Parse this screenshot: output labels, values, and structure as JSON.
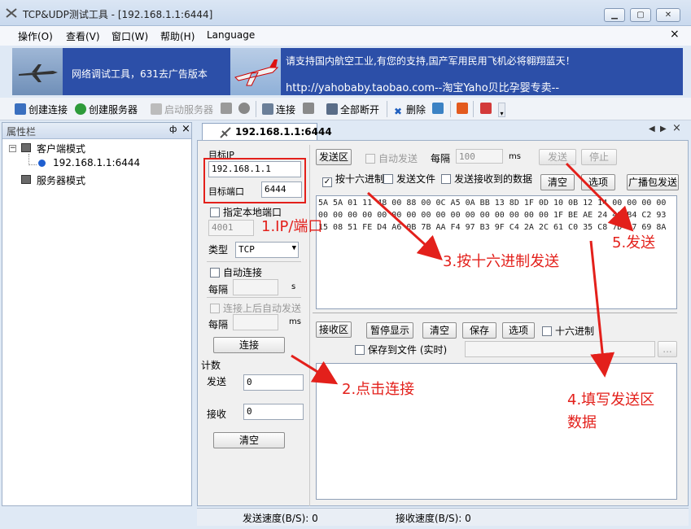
{
  "window": {
    "title": "TCP&UDP测试工具 - [192.168.1.1:6444]"
  },
  "menu": {
    "items": [
      "操作(O)",
      "查看(V)",
      "窗口(W)",
      "帮助(H)",
      "Language"
    ],
    "close": "×"
  },
  "banner": {
    "left_text": "网络调试工具，631去广告版本",
    "right_line1": "请支持国内航空工业,有您的支持,国产军用民用飞机必将翱翔蓝天！",
    "right_line2": "http://yahobaby.taobao.com--淘宝Yaho贝比孕婴专卖--"
  },
  "toolbar": {
    "create_connection": "创建连接",
    "create_server": "创建服务器",
    "start_server": "启动服务器",
    "connect": "连接",
    "disconnect_all": "全部断开",
    "delete": "删除"
  },
  "left_panel": {
    "title": "属性栏",
    "pin": "ф",
    "close": "×",
    "tree": {
      "client_mode": "客户端模式",
      "connection": "192.168.1.1:6444",
      "server_mode": "服务器模式"
    }
  },
  "tab": {
    "label": "192.168.1.1:6444"
  },
  "config": {
    "target_ip_label": "目标IP",
    "target_ip_value": "192.168.1.1",
    "target_port_label": "目标端口",
    "target_port_value": "6444",
    "local_port_label": "指定本地端口",
    "local_port_value": "4001",
    "type_label": "类型",
    "type_value": "TCP",
    "auto_connect_label": "自动连接",
    "interval_label": "每隔",
    "interval_unit_s": "s",
    "auto_send_after_connect_label": "连接上后自动发送",
    "interval_unit_ms": "ms",
    "connect_button": "连接",
    "count_label": "计数",
    "send_label": "发送",
    "send_count": "0",
    "recv_label": "接收",
    "recv_count": "0",
    "clear_button": "清空"
  },
  "send": {
    "area_label": "发送区",
    "auto_send_label": "自动发送",
    "interval_label": "每隔",
    "interval_value": "100",
    "interval_unit": "ms",
    "send_button": "发送",
    "stop_button": "停止",
    "hex_send_label": "按十六进制",
    "send_file_label": "发送文件",
    "send_received_label": "发送接收到的数据",
    "clear_button": "清空",
    "options_button": "选项",
    "broadcast_button": "广播包发送",
    "hex_lines": [
      "5A 5A 01 11 48 00 88 00 0C A5 0A BB 13 8D 1F 0D 10 0B 12 14 00 00 00 00",
      "00 00 00 00 00 00 00 00 00 00 00 00 00 00 00 00 1F BE AE 24 49 B4 C2 93",
      "15 08 51 FE D4 A6 0B 7B AA F4 97 B3 9F C4 2A 2C 61 C0 35 C8 7D 97 69 8A"
    ]
  },
  "receive": {
    "area_label": "接收区",
    "pause_button": "暂停显示",
    "clear_button": "清空",
    "save_button": "保存",
    "options_button": "选项",
    "hex_label": "十六进制",
    "save_to_file_label": "保存到文件 (实时)",
    "browse_button": "..."
  },
  "status": {
    "send_speed": "发送速度(B/S): 0",
    "recv_speed": "接收速度(B/S): 0"
  },
  "annotations": {
    "a1": "1.IP/端口",
    "a2": "2.点击连接",
    "a3": "3.按十六进制发送",
    "a4_line1": "4.填写发送区",
    "a4_line2": "数据",
    "a5": "5.发送"
  },
  "colors": {
    "annotation": "#e3201b",
    "banner": "#2c4fa8"
  }
}
